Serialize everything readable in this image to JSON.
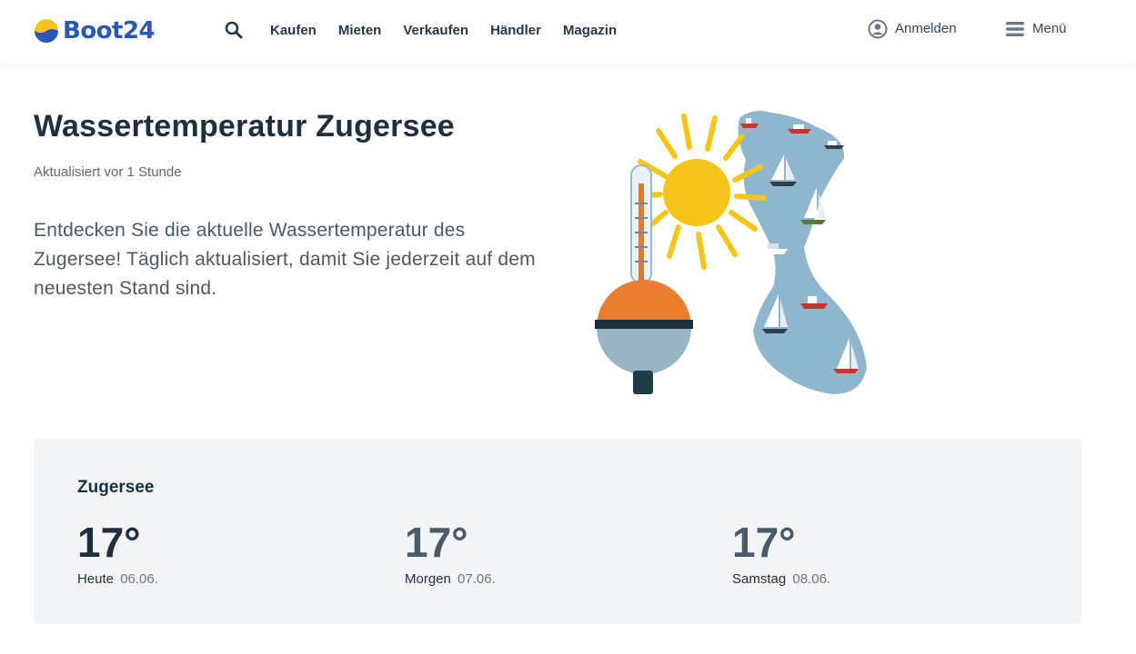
{
  "header": {
    "logo_text": "Boot24",
    "nav": [
      "Kaufen",
      "Mieten",
      "Verkaufen",
      "Händler",
      "Magazin"
    ],
    "login_label": "Anmelden",
    "menu_label": "Menü",
    "icons": {
      "search": "search-icon",
      "login": "user-circle-icon",
      "menu": "hamburger-icon"
    }
  },
  "main": {
    "title": "Wassertemperatur Zugersee",
    "updated": "Aktualisiert vor 1 Stunde",
    "intro": "Entdecken Sie die aktuelle Wassertemperatur des Zugersee! Täglich aktualisiert, damit Sie jederzeit auf dem neuesten Stand sind."
  },
  "forecast": {
    "lake": "Zugersee",
    "days": [
      {
        "temp": "17°",
        "label": "Heute",
        "date": "06.06."
      },
      {
        "temp": "17°",
        "label": "Morgen",
        "date": "07.06."
      },
      {
        "temp": "17°",
        "label": "Samstag",
        "date": "08.06."
      }
    ]
  },
  "colors": {
    "brand_blue": "#2a56b8",
    "brand_yellow": "#f5c518",
    "text_dark": "#1f2f3f",
    "card_bg": "#f2f4f6"
  }
}
